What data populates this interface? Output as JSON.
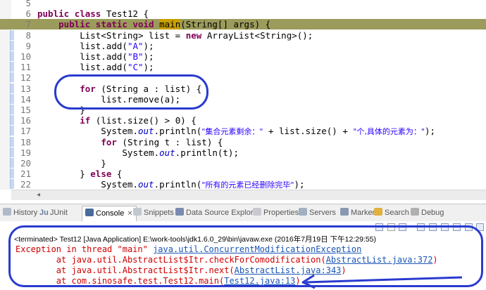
{
  "editor": {
    "lines": [
      {
        "num": "5"
      },
      {
        "num": "6",
        "parts": [
          [
            "kw",
            "public"
          ],
          [
            "p",
            " "
          ],
          [
            "kw",
            "class"
          ],
          [
            "p",
            " Test12 {"
          ]
        ]
      },
      {
        "num": "7",
        "parts": [
          [
            "p",
            "    "
          ],
          [
            "kw",
            "public"
          ],
          [
            "p",
            " "
          ],
          [
            "kw",
            "static"
          ],
          [
            "p",
            " "
          ],
          [
            "kw",
            "void"
          ],
          [
            "p",
            " "
          ],
          [
            "main",
            "main"
          ],
          [
            "p",
            "(String[] args) {"
          ]
        ],
        "highlight": true
      },
      {
        "num": "8",
        "parts": [
          [
            "p",
            "        List<String> list = "
          ],
          [
            "kw",
            "new"
          ],
          [
            "p",
            " ArrayList<String>();"
          ]
        ]
      },
      {
        "num": "9",
        "parts": [
          [
            "p",
            "        list.add("
          ],
          [
            "str",
            "\"A\""
          ],
          [
            "p",
            ");"
          ]
        ]
      },
      {
        "num": "10",
        "parts": [
          [
            "p",
            "        list.add("
          ],
          [
            "str",
            "\"B\""
          ],
          [
            "p",
            ");"
          ]
        ]
      },
      {
        "num": "11",
        "parts": [
          [
            "p",
            "        list.add("
          ],
          [
            "str",
            "\"C\""
          ],
          [
            "p",
            ");"
          ]
        ]
      },
      {
        "num": "12"
      },
      {
        "num": "13",
        "parts": [
          [
            "p",
            "        "
          ],
          [
            "kw",
            "for"
          ],
          [
            "p",
            " (String a : list) {"
          ]
        ]
      },
      {
        "num": "14",
        "parts": [
          [
            "p",
            "            list.remove(a);"
          ]
        ]
      },
      {
        "num": "15",
        "parts": [
          [
            "p",
            "        }"
          ]
        ]
      },
      {
        "num": "16",
        "parts": [
          [
            "p",
            "        "
          ],
          [
            "kw",
            "if"
          ],
          [
            "p",
            " (list.size() > 0) {"
          ]
        ]
      },
      {
        "num": "17",
        "parts": [
          [
            "p",
            "            System."
          ],
          [
            "fld",
            "out"
          ],
          [
            "p",
            ".println("
          ],
          [
            "str",
            "\"集合元素剩余：\""
          ],
          [
            "p",
            " + list.size() + "
          ],
          [
            "str",
            "\"个,具体的元素为：\""
          ],
          [
            "p",
            ");"
          ]
        ]
      },
      {
        "num": "18",
        "parts": [
          [
            "p",
            "            "
          ],
          [
            "kw",
            "for"
          ],
          [
            "p",
            " (String t : list) {"
          ]
        ]
      },
      {
        "num": "19",
        "parts": [
          [
            "p",
            "                System."
          ],
          [
            "fld",
            "out"
          ],
          [
            "p",
            ".println(t);"
          ]
        ]
      },
      {
        "num": "20",
        "parts": [
          [
            "p",
            "            }"
          ]
        ]
      },
      {
        "num": "21",
        "parts": [
          [
            "p",
            "        } "
          ],
          [
            "kw",
            "else"
          ],
          [
            "p",
            " {"
          ]
        ]
      },
      {
        "num": "22",
        "parts": [
          [
            "p",
            "            System."
          ],
          [
            "fld",
            "out"
          ],
          [
            "p",
            ".println("
          ],
          [
            "str",
            "\"所有的元素已经删除完毕\""
          ],
          [
            "p",
            ");"
          ]
        ]
      },
      {
        "num": "",
        "parts": [
          [
            "p",
            "        }"
          ]
        ]
      }
    ]
  },
  "tabs": [
    {
      "label": "History",
      "color": "#b0b8c8"
    },
    {
      "label": "JUnit",
      "color": "#9aa0b0",
      "prefix": "Ju"
    },
    {
      "label": "Console",
      "color": "#4a6a9a",
      "active": true,
      "close": "✕"
    },
    {
      "label": "Snippets",
      "color": "#c0c8d0"
    },
    {
      "label": "Data Source Explorer",
      "color": "#7a8ab0"
    },
    {
      "label": "Properties",
      "color": "#c8c8d0"
    },
    {
      "label": "Servers",
      "color": "#a0b0c0"
    },
    {
      "label": "Markers",
      "color": "#8898b0"
    },
    {
      "label": "Search",
      "color": "#e0b040"
    },
    {
      "label": "Debug",
      "color": "#b0b0b0"
    }
  ],
  "console": {
    "status": "<terminated> Test12 [Java Application] E:\\work-tools\\jdk1.6.0_29\\bin\\javaw.exe (2016年7月19日 下午12:29:55)",
    "lines": [
      [
        [
          "err",
          "Exception in thread \"main\" "
        ],
        [
          "link",
          "java.util.ConcurrentModificationException"
        ]
      ],
      [
        [
          "err",
          "\tat java.util.AbstractList$Itr.checkForComodification("
        ],
        [
          "link",
          "AbstractList.java:372"
        ],
        [
          "err",
          ")"
        ]
      ],
      [
        [
          "err",
          "\tat java.util.AbstractList$Itr.next("
        ],
        [
          "link",
          "AbstractList.java:343"
        ],
        [
          "err",
          ")"
        ]
      ],
      [
        [
          "err",
          "\tat com.sinosafe.test.Test12.main("
        ],
        [
          "link",
          "Test12.java:13"
        ],
        [
          "err",
          ")"
        ]
      ]
    ]
  },
  "colors": {
    "keyword": "#7f0055",
    "string": "#2a00ff",
    "error": "#d00000",
    "link": "#1a55b5",
    "annotation": "#2a3bcf"
  }
}
